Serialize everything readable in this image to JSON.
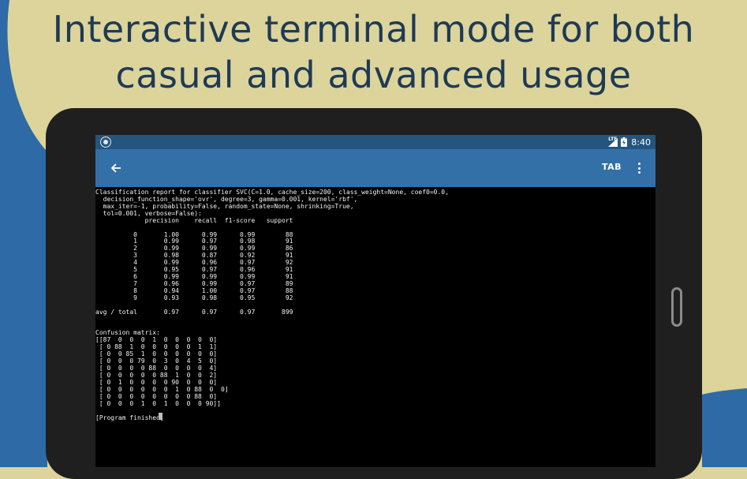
{
  "headline": {
    "line1": "Interactive terminal mode for both",
    "line2": "casual and advanced usage"
  },
  "colors": {
    "background_tan": "#dcd49a",
    "background_blue": "#2e6aa6",
    "headline_text": "#1f3a55",
    "status_bar": "#24557f",
    "toolbar": "#3470a8",
    "terminal_bg": "#000000",
    "terminal_text": "#f2f2f2"
  },
  "status_bar": {
    "network_label": "LTE",
    "time": "8:40",
    "left_icon": "circle-notification-icon",
    "right_icons": [
      "signal-icon",
      "battery-icon"
    ]
  },
  "toolbar": {
    "back_icon": "arrow-left-icon",
    "tab_label": "TAB",
    "menu_icon": "more-vert-icon"
  },
  "terminal": {
    "lines": [
      "Classification report for classifier SVC(C=1.0, cache_size=200, class_weight=None, coef0=0.0,",
      "  decision_function_shape='ovr', degree=3, gamma=0.001, kernel='rbf',",
      "  max_iter=-1, probability=False, random_state=None, shrinking=True,",
      "  tol=0.001, verbose=False):",
      "             precision    recall  f1-score   support",
      "",
      "          0       1.00      0.99      0.99        88",
      "          1       0.99      0.97      0.98        91",
      "          2       0.99      0.99      0.99        86",
      "          3       0.98      0.87      0.92        91",
      "          4       0.99      0.96      0.97        92",
      "          5       0.95      0.97      0.96        91",
      "          6       0.99      0.99      0.99        91",
      "          7       0.96      0.99      0.97        89",
      "          8       0.94      1.00      0.97        88",
      "          9       0.93      0.98      0.95        92",
      "",
      "avg / total       0.97      0.97      0.97       899",
      "",
      "",
      "Confusion matrix:",
      "[[87  0  0  0  1  0  0  0  0  0]",
      " [ 0 88  1  0  0  0  0  0  1  1]",
      " [ 0  0 85  1  0  0  0  0  0  0]",
      " [ 0  0  0 79  0  3  0  4  5  0]",
      " [ 0  0  0  0 88  0  0  0  0  4]",
      " [ 0  0  0  0  0 88  1  0  0  2]",
      " [ 0  1  0  0  0  0 90  0  0  0]",
      " [ 0  0  0  0  0  0  1  0 88  0  0]",
      " [ 0  0  0  0  0  0  0  0 88  0]",
      " [ 0  0  0  1  0  1  0  0  0 90]]",
      "",
      "[Program finished]"
    ]
  }
}
